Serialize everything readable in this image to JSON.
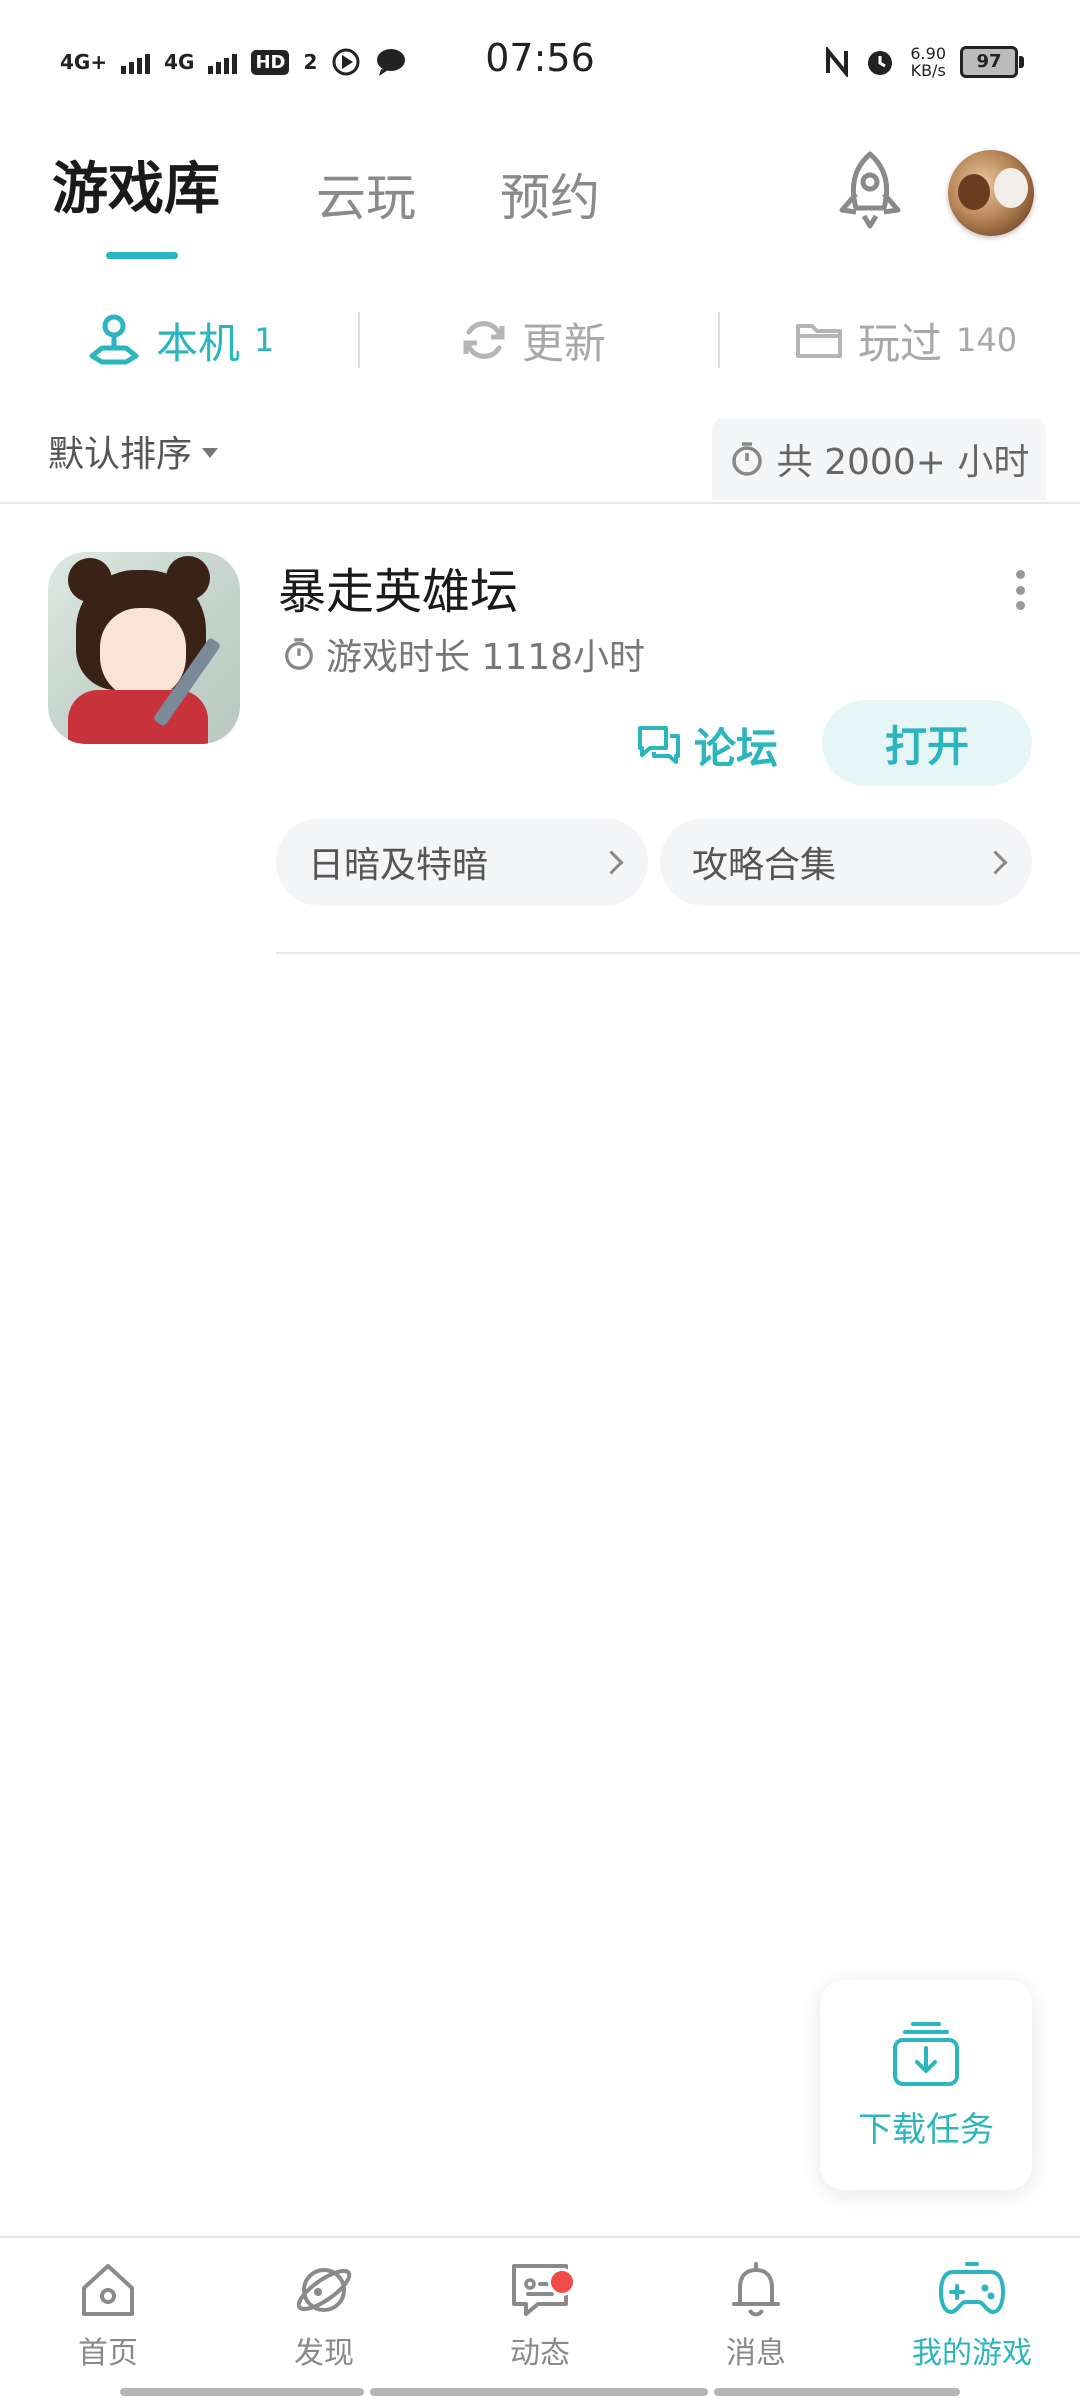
{
  "status_bar": {
    "network1": "4G+",
    "network2": "4G",
    "hd_label": "HD",
    "hd_sub": "2",
    "time": "07:56",
    "speed_value": "6.90",
    "speed_unit": "KB/s",
    "battery": "97"
  },
  "top_tabs": [
    {
      "label": "游戏库",
      "active": true
    },
    {
      "label": "云玩",
      "active": false
    },
    {
      "label": "预约",
      "active": false
    }
  ],
  "sub_tabs": [
    {
      "label": "本机",
      "count": "1",
      "icon": "joystick-icon",
      "active": true
    },
    {
      "label": "更新",
      "count": "",
      "icon": "refresh-icon",
      "active": false
    },
    {
      "label": "玩过",
      "count": "140",
      "icon": "folder-icon",
      "active": false
    }
  ],
  "sort": {
    "label": "默认排序"
  },
  "total_time": {
    "label": "共 2000+ 小时"
  },
  "game": {
    "name": "暴走英雄坛",
    "playtime": "游戏时长 1118小时",
    "forum_label": "论坛",
    "open_label": "打开",
    "chips": [
      "日暗及特暗",
      "攻略合集"
    ]
  },
  "download": {
    "label": "下载任务"
  },
  "bottom_nav": [
    {
      "label": "首页",
      "icon": "home-icon",
      "active": false
    },
    {
      "label": "发现",
      "icon": "planet-icon",
      "active": false
    },
    {
      "label": "动态",
      "icon": "message-icon",
      "active": false,
      "badge": true
    },
    {
      "label": "消息",
      "icon": "bell-icon",
      "active": false
    },
    {
      "label": "我的游戏",
      "icon": "gamepad-icon",
      "active": true
    }
  ],
  "colors": {
    "accent": "#2ab5bf",
    "badge": "#ef4b4b"
  }
}
